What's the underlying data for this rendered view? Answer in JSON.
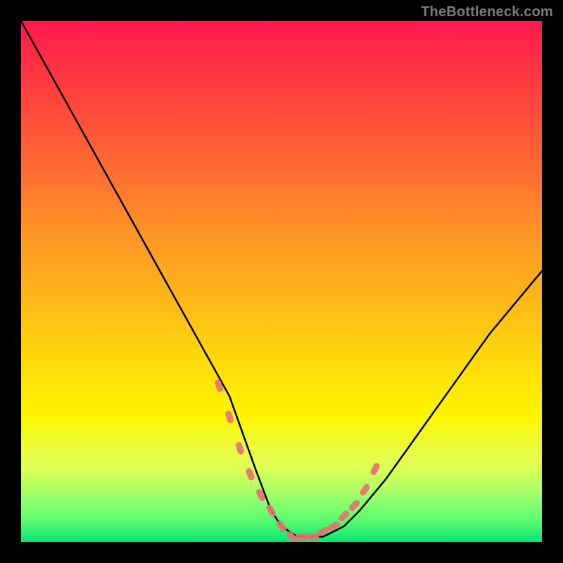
{
  "watermark": "TheBottleneck.com",
  "colors": {
    "background": "#000000",
    "gradient_top": "#ff1a4d",
    "gradient_bottom": "#00e676",
    "curve": "#000000",
    "marker": "#e57373"
  },
  "chart_data": {
    "type": "line",
    "title": "",
    "xlabel": "",
    "ylabel": "",
    "xlim": [
      0,
      100
    ],
    "ylim": [
      0,
      100
    ],
    "grid": false,
    "legend": false,
    "series": [
      {
        "name": "bottleneck-curve",
        "x": [
          0,
          5,
          10,
          15,
          20,
          25,
          30,
          35,
          40,
          45,
          48,
          50,
          53,
          55,
          58,
          60,
          62,
          65,
          70,
          75,
          80,
          85,
          90,
          95,
          100
        ],
        "values": [
          100,
          91,
          82,
          73,
          64,
          55,
          46,
          37,
          28,
          14,
          6,
          3,
          1,
          1,
          1,
          2,
          3,
          6,
          12,
          19,
          26,
          33,
          40,
          46,
          52
        ]
      }
    ],
    "markers": {
      "name": "highlighted-range",
      "x": [
        38,
        40,
        42,
        44,
        46,
        48,
        50,
        52,
        54,
        56,
        58,
        60,
        62,
        64,
        66,
        68
      ],
      "values": [
        30,
        24,
        18,
        13,
        9,
        6,
        3,
        1,
        1,
        1,
        2,
        3,
        5,
        7,
        10,
        14
      ]
    }
  }
}
